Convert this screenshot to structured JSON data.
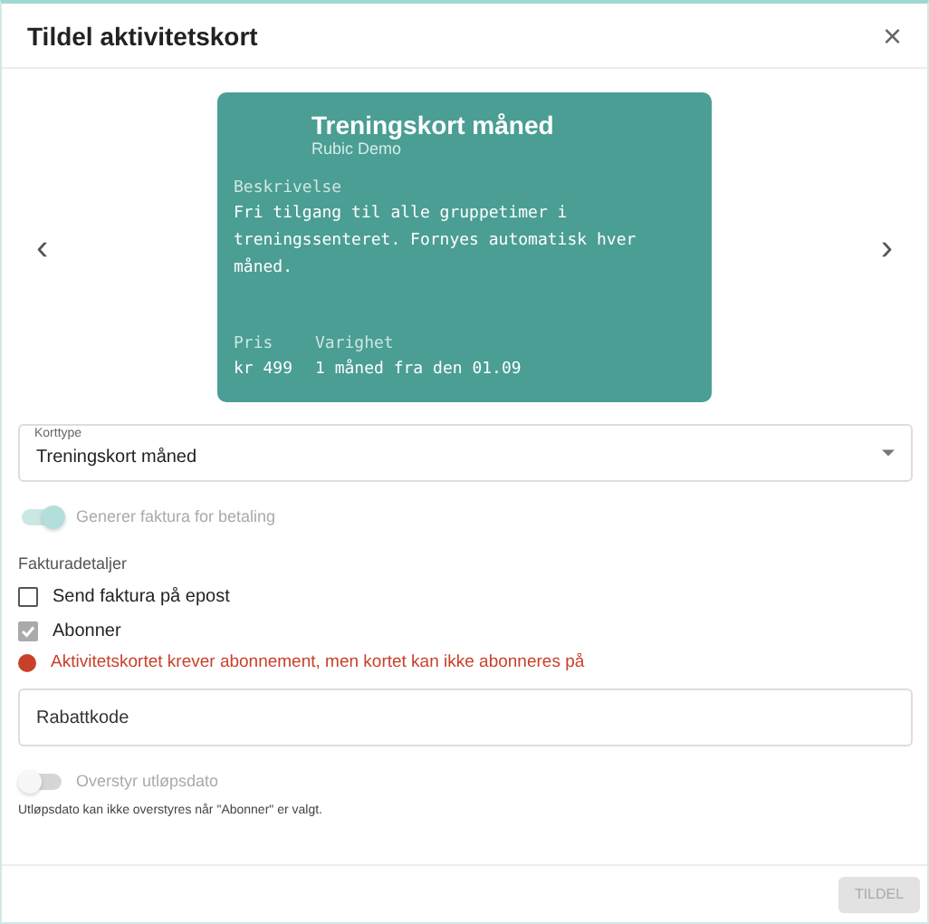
{
  "dialog": {
    "title": "Tildel aktivitetskort",
    "close": "×"
  },
  "card": {
    "title": "Treningskort måned",
    "subtitle": "Rubic Demo",
    "description_label": "Beskrivelse",
    "description": "Fri tilgang til alle gruppetimer i treningssenteret. Fornyes automatisk hver måned.",
    "price_label": "Pris",
    "price": "kr 499",
    "duration_label": "Varighet",
    "duration": "1 måned fra den 01.09",
    "prev": "‹",
    "next": "›"
  },
  "card_type": {
    "label": "Korttype",
    "value": "Treningskort måned"
  },
  "invoice_toggle": {
    "label": "Generer faktura for betaling",
    "on": true,
    "disabled": true
  },
  "invoice_details": {
    "heading": "Fakturadetaljer",
    "options": [
      {
        "label": "Send faktura på epost",
        "checked": false,
        "disabled": false
      },
      {
        "label": "Abonner",
        "checked": true,
        "disabled": true
      }
    ]
  },
  "error": "Aktivitetskortet krever abonnement, men kortet kan ikke abonneres på",
  "discount": {
    "placeholder": "Rabattkode"
  },
  "expiry_toggle": {
    "label": "Overstyr utløpsdato",
    "on": false,
    "disabled": true,
    "hint": "Utløpsdato kan ikke overstyres når \"Abonner\" er valgt."
  },
  "submit": {
    "label": "TILDEL",
    "disabled": true
  }
}
